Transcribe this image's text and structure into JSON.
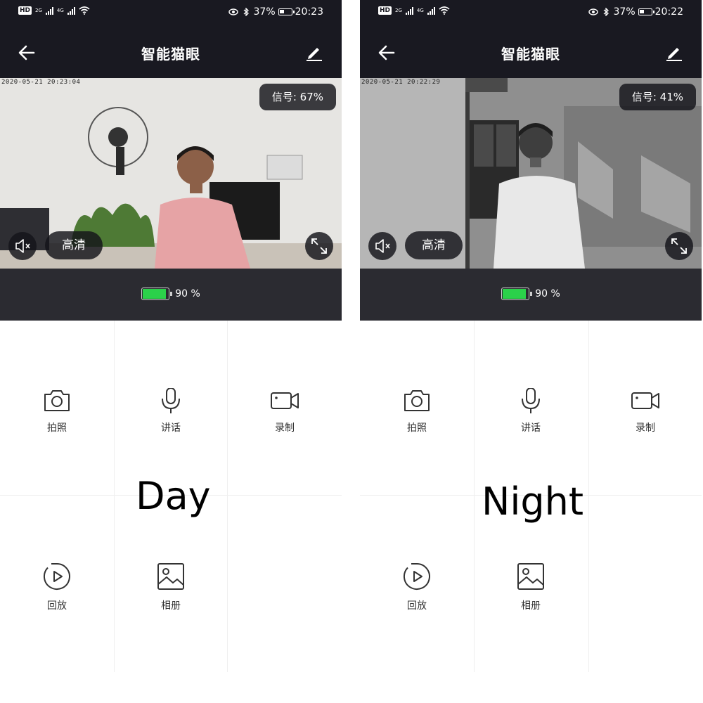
{
  "screens": [
    {
      "status": {
        "battery_pct": "37%",
        "time": "20:23",
        "net_a": "2G",
        "net_b": "4G",
        "hd": "HD"
      },
      "title": "智能猫眼",
      "timestamp": "2020-05-21  20:23:04",
      "signal": "信号: 67%",
      "quality": "高清",
      "device_battery": "90 %",
      "device_battery_level": 0.9,
      "actions": [
        {
          "label": "拍照",
          "icon": "camera-icon"
        },
        {
          "label": "讲话",
          "icon": "microphone-icon"
        },
        {
          "label": "录制",
          "icon": "video-icon"
        },
        {
          "label": "回放",
          "icon": "playback-icon"
        },
        {
          "label": "相册",
          "icon": "album-icon"
        }
      ],
      "caption": "Day"
    },
    {
      "status": {
        "battery_pct": "37%",
        "time": "20:22",
        "net_a": "2G",
        "net_b": "4G",
        "hd": "HD"
      },
      "title": "智能猫眼",
      "timestamp": "2020-05-21  20:22:29",
      "signal": "信号: 41%",
      "quality": "高清",
      "device_battery": "90 %",
      "device_battery_level": 0.9,
      "actions": [
        {
          "label": "拍照",
          "icon": "camera-icon"
        },
        {
          "label": "讲话",
          "icon": "microphone-icon"
        },
        {
          "label": "录制",
          "icon": "video-icon"
        },
        {
          "label": "回放",
          "icon": "playback-icon"
        },
        {
          "label": "相册",
          "icon": "album-icon"
        }
      ],
      "caption": "Night"
    }
  ],
  "colors": {
    "header_bg": "#191921",
    "battery_bar_bg": "#2b2b31",
    "battery_green": "#2bd14a",
    "overlay_bg": "#14141a"
  }
}
